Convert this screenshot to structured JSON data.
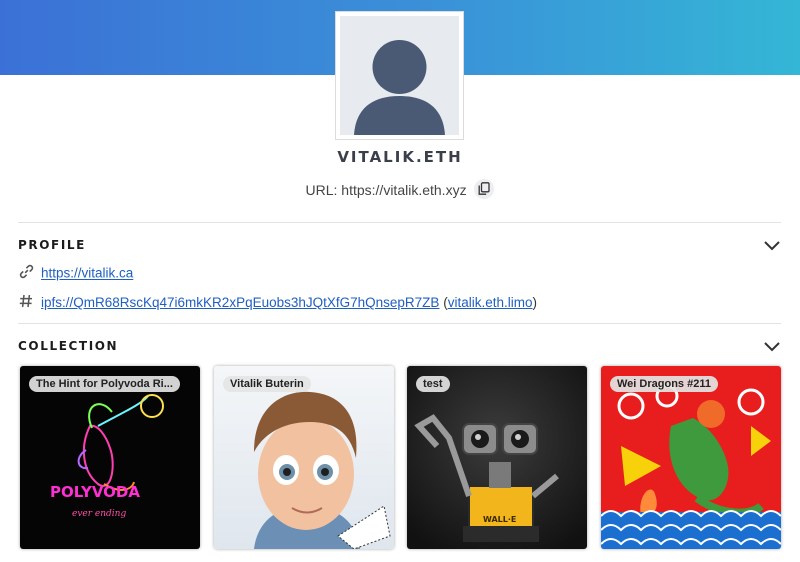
{
  "profile": {
    "name": "VITALIK.ETH",
    "url_label": "URL: https://vitalik.eth.xyz"
  },
  "sections": {
    "profile_title": "PROFILE",
    "collection_title": "COLLECTION"
  },
  "links": {
    "website": "https://vitalik.ca",
    "ipfs": "ipfs://QmR68RscKq47i6mkKR2xPqEuobs3hJQtXfG7hQnsepR7ZB",
    "ipfs_gateway_open": "(",
    "ipfs_gateway": "vitalik.eth.limo",
    "ipfs_gateway_close": ")"
  },
  "collection": [
    {
      "title": "The Hint for Polyvoda Ri...",
      "caption": "POLYVODA",
      "subcaption": "ever ending"
    },
    {
      "title": "Vitalik Buterin"
    },
    {
      "title": "test",
      "caption": "WALL·E"
    },
    {
      "title": "Wei Dragons #211"
    }
  ],
  "icons": {
    "link": "link-icon",
    "hash": "hash-icon",
    "copy": "copy-icon",
    "chevron": "chevron-down-icon"
  },
  "colors": {
    "banner_start": "#3b71d6",
    "banner_end": "#34b6d6",
    "link": "#1f5fc2"
  }
}
